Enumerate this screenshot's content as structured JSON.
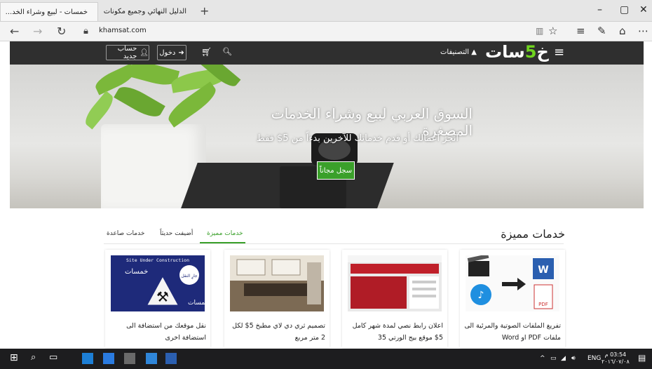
{
  "browser": {
    "tabs": [
      {
        "title": "خمسات - لبيع وشراء الخد...",
        "active": true
      },
      {
        "title": "الدليل النهائي وجميع مكونات",
        "active": false
      }
    ],
    "url": "khamsat.com",
    "new_tab_symbol": "+",
    "close_symbol": "✕",
    "window_controls": {
      "minimize": "–",
      "maximize": "▢",
      "close": "✕"
    },
    "more_symbol": "⋯"
  },
  "header": {
    "logo_prefix": "خ",
    "logo_five": "5",
    "logo_suffix": "سات",
    "categories_label": "التصنيفات",
    "login_label": "دخول",
    "register_label": "حساب جديد"
  },
  "hero": {
    "title": "السوق العربي لبيع وشراء الخدمات المصغرة",
    "subtitle": "أنجز أعمالك أو قدم خدماتك للآخرين بدءاً من 5$ فقط",
    "cta_label": "سجل مجاناً"
  },
  "section": {
    "title": "خدمات مميزة",
    "tabs": [
      {
        "label": "خدمات مميزة",
        "active": true
      },
      {
        "label": "أضيفت حديثاً",
        "active": false
      },
      {
        "label": "خدمات صاعدة",
        "active": false
      }
    ]
  },
  "cards": [
    {
      "title": "تفريغ الملفات الصوتية والمرئية الى ملفات PDF او Word"
    },
    {
      "title": "اعلان رابط نصي لمدة شهر كامل 5$ موقع بيج الورتي 35"
    },
    {
      "title": "تصميم ثري دي لاي مطبخ 5$ لكل 2 متر مربع"
    },
    {
      "title": "نقل موقعك من استضافة الى استضافة اخرى"
    }
  ],
  "thumb_texts": {
    "construction": "Site Under Construction",
    "brand": "خمسات",
    "badge": "جارٍ النقل",
    "pdf": "PDF"
  },
  "taskbar": {
    "lang": "ENG",
    "time": "03:54 م",
    "date": "٢٠١٦/٠٧/٠٨"
  },
  "colors": {
    "accent": "#3aa02a",
    "header_bg": "#2f2f2f",
    "taskbar_bg": "#1d1d1f"
  }
}
